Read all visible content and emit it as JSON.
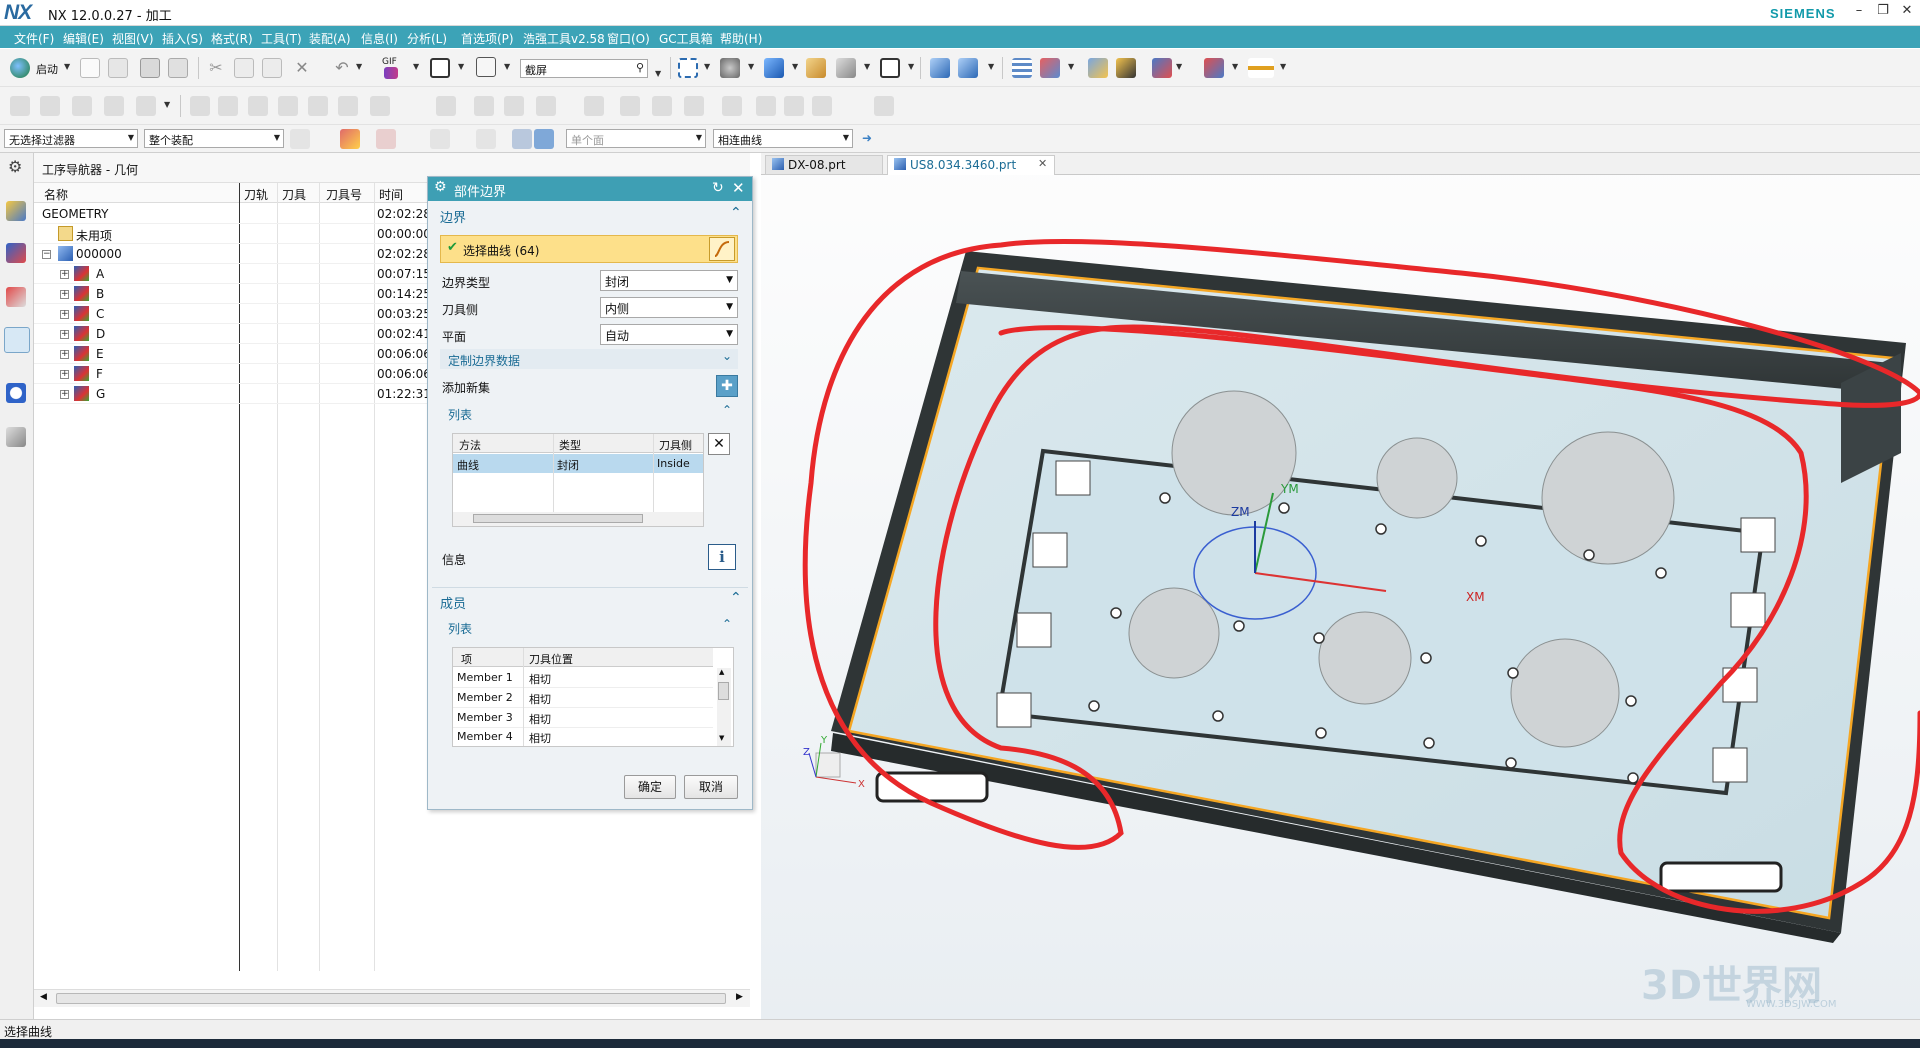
{
  "window": {
    "title": "NX 12.0.0.27 - 加工",
    "brand": "SIEMENS",
    "logo": "NX"
  },
  "menu": [
    "文件(F)",
    "编辑(E)",
    "视图(V)",
    "插入(S)",
    "格式(R)",
    "工具(T)",
    "装配(A)",
    "信息(I)",
    "分析(L)",
    "首选项(P)",
    "浩强工具v2.58",
    "窗口(O)",
    "GC工具箱",
    "帮助(H)"
  ],
  "toolbar": {
    "start_label": "启动",
    "gif_label": "GIF",
    "search_value": "截屏"
  },
  "filterbar": {
    "filter": "无选择过滤器",
    "assembly": "整个装配",
    "face_rule": "单个面",
    "curve_rule": "相连曲线"
  },
  "navigator": {
    "title": "工序导航器 - 几何",
    "columns": [
      "名称",
      "刀轨",
      "刀具",
      "刀具号",
      "时间"
    ],
    "rows": [
      {
        "name": "GEOMETRY",
        "time": "02:02:28"
      },
      {
        "name": "未用项",
        "time": "00:00:00"
      },
      {
        "name": "000000",
        "time": "02:02:28"
      },
      {
        "name": "A",
        "time": "00:07:15"
      },
      {
        "name": "B",
        "time": "00:14:25"
      },
      {
        "name": "C",
        "time": "00:03:25"
      },
      {
        "name": "D",
        "time": "00:02:41"
      },
      {
        "name": "E",
        "time": "00:06:06"
      },
      {
        "name": "F",
        "time": "00:06:06"
      },
      {
        "name": "G",
        "time": "01:22:31"
      }
    ]
  },
  "dialog": {
    "title": "部件边界",
    "boundary_section": "边界",
    "select_curve": "选择曲线 (64)",
    "boundary_type_label": "边界类型",
    "boundary_type": "封闭",
    "tool_side_label": "刀具侧",
    "tool_side": "内侧",
    "plane_label": "平面",
    "plane": "自动",
    "custom_data": "定制边界数据",
    "add_new_set": "添加新集",
    "list_label": "列表",
    "list_columns": [
      "方法",
      "类型",
      "刀具侧"
    ],
    "list_row": [
      "曲线",
      "封闭",
      "Inside"
    ],
    "info_label": "信息",
    "members_section": "成员",
    "members_list_label": "列表",
    "member_columns": [
      "项",
      "刀具位置"
    ],
    "members": [
      [
        "Member 1",
        "相切"
      ],
      [
        "Member 2",
        "相切"
      ],
      [
        "Member 3",
        "相切"
      ],
      [
        "Member 4",
        "相切"
      ]
    ],
    "ok": "确定",
    "cancel": "取消"
  },
  "tabs": [
    {
      "label": "DX-08.prt"
    },
    {
      "label": "US8.034.3460.prt"
    }
  ],
  "viewport": {
    "axis_xm": "XM",
    "axis_ym": "YM",
    "axis_zm": "ZM",
    "tri_x": "X",
    "tri_y": "Y",
    "tri_z": "Z"
  },
  "watermark": {
    "text": "3D世界网",
    "sub": "WWW.3DSJW.COM"
  },
  "status": {
    "text": "选择曲线"
  },
  "colors": {
    "menubar": "#3ca3b7",
    "accent": "#1b6c95",
    "highlight": "#fde08a",
    "selection": "#f5a623",
    "redline": "#e8282a"
  }
}
